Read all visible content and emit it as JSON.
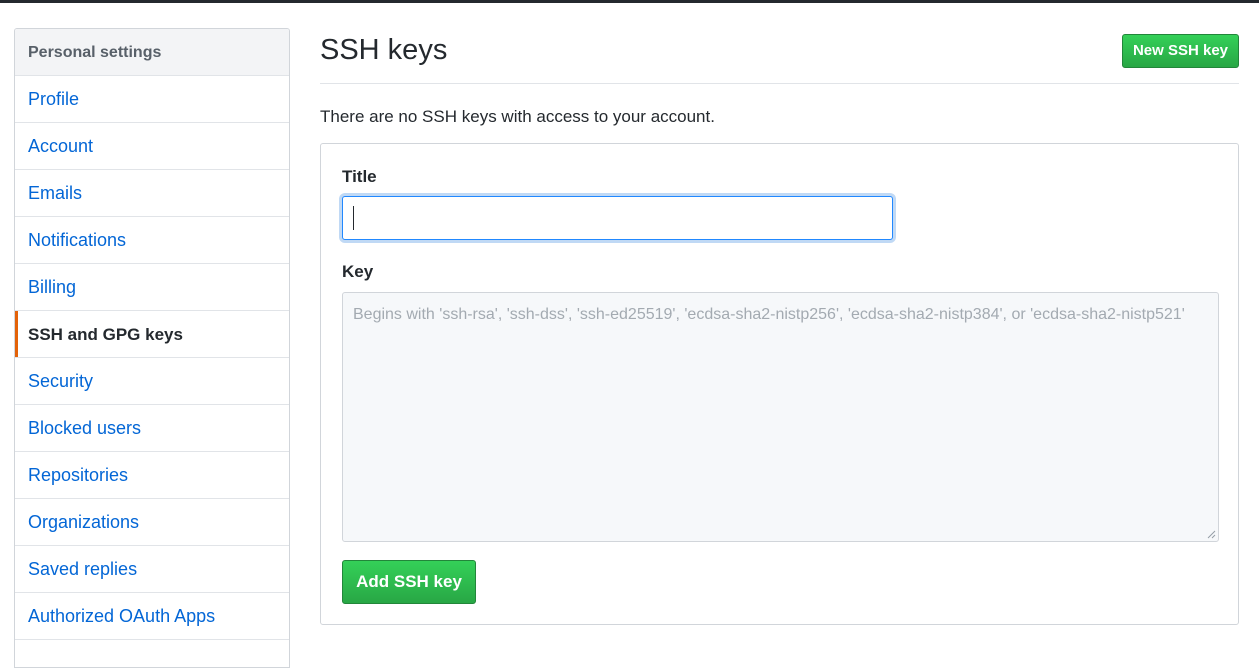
{
  "sidebar": {
    "header": "Personal settings",
    "items": [
      {
        "label": "Profile"
      },
      {
        "label": "Account"
      },
      {
        "label": "Emails"
      },
      {
        "label": "Notifications"
      },
      {
        "label": "Billing"
      },
      {
        "label": "SSH and GPG keys",
        "selected": true
      },
      {
        "label": "Security"
      },
      {
        "label": "Blocked users"
      },
      {
        "label": "Repositories"
      },
      {
        "label": "Organizations"
      },
      {
        "label": "Saved replies"
      },
      {
        "label": "Authorized OAuth Apps"
      }
    ]
  },
  "main": {
    "title": "SSH keys",
    "new_key_label": "New SSH key",
    "empty_message": "There are no SSH keys with access to your account.",
    "form": {
      "title_label": "Title",
      "title_value": "",
      "key_label": "Key",
      "key_placeholder": "Begins with 'ssh-rsa', 'ssh-dss', 'ssh-ed25519', 'ecdsa-sha2-nistp256', 'ecdsa-sha2-nistp384', or 'ecdsa-sha2-nistp521'",
      "submit_label": "Add SSH key"
    }
  },
  "colors": {
    "link": "#0366d6",
    "selected_accent": "#e36209",
    "primary_button": "#28a745"
  }
}
